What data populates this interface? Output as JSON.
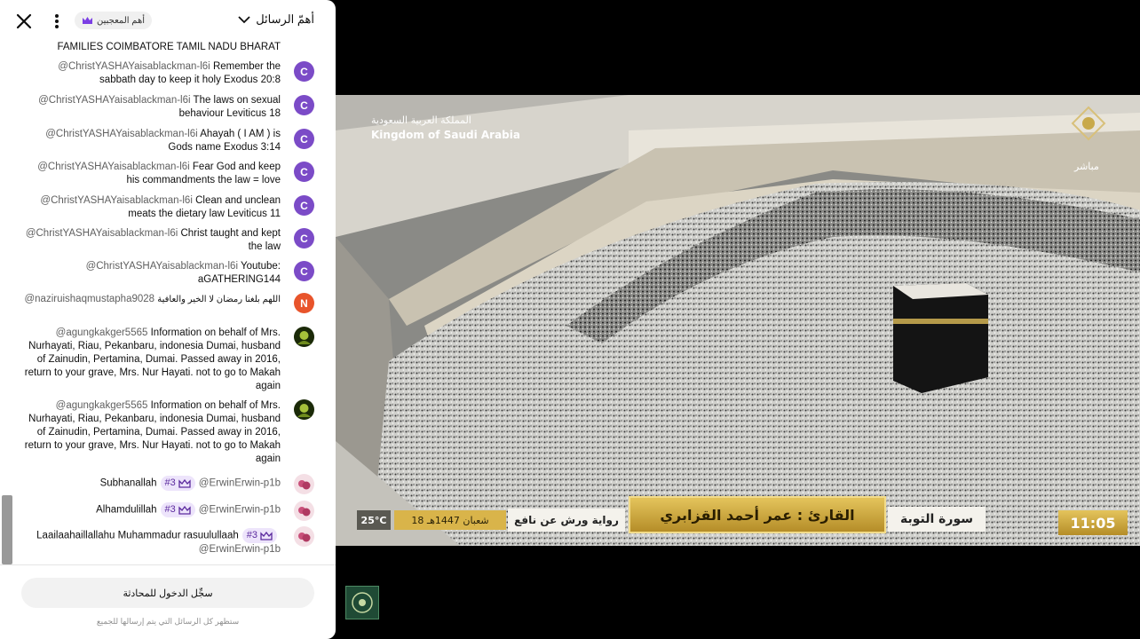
{
  "chat": {
    "header": {
      "title": "أهمّ الرسائل",
      "top_fans_label": "أهم المعجبين",
      "close_icon": "close-icon",
      "more_icon": "more-vert-icon",
      "dropdown_icon": "chevron-down-icon"
    },
    "partial_line": "FAMILIES COIMBATORE TAMIL NADU BHARAT",
    "messages": [
      {
        "author": "@ChristYASHAYaisablackman-l6i",
        "text": "Remember the sabbath day to keep it holy Exodus 20:8",
        "avatar": "C",
        "avatar_color": "#7b4bc7"
      },
      {
        "author": "@ChristYASHAYaisablackman-l6i",
        "text": "The laws on sexual behaviour Leviticus 18",
        "avatar": "C",
        "avatar_color": "#7b4bc7"
      },
      {
        "author": "@ChristYASHAYaisablackman-l6i",
        "text": "Ahayah ( I AM ) is Gods name Exodus 3:14",
        "avatar": "C",
        "avatar_color": "#7b4bc7"
      },
      {
        "author": "@ChristYASHAYaisablackman-l6i",
        "text": "Fear God and keep his commandments the law = love",
        "avatar": "C",
        "avatar_color": "#7b4bc7"
      },
      {
        "author": "@ChristYASHAYaisablackman-l6i",
        "text": "Clean and unclean meats the dietary law Leviticus 11",
        "avatar": "C",
        "avatar_color": "#7b4bc7"
      },
      {
        "author": "@ChristYASHAYaisablackman-l6i",
        "text": "Christ taught and kept the law",
        "avatar": "C",
        "avatar_color": "#7b4bc7"
      },
      {
        "author": "@ChristYASHAYaisablackman-l6i",
        "text": "Youtube: aGATHERING144",
        "avatar": "C",
        "avatar_color": "#7b4bc7"
      },
      {
        "author": "@naziruishaqmustapha9028",
        "text": "اللهم بلغنا رمضان لا الخير والعافية",
        "avatar": "N",
        "avatar_color": "#e8542b"
      },
      {
        "author": "@agungkakger5565",
        "text": "Information on behalf of Mrs. Nurhayati, Riau, Pekanbaru, indonesia Dumai, husband of Zainudin, Pertamina, Dumai. Passed away in 2016, return to your grave, Mrs. Nur Hayati. not to go to Makah again",
        "avatar": "",
        "avatar_color": "#3c5a14"
      },
      {
        "author": "@agungkakger5565",
        "text": "Information on behalf of Mrs. Nurhayati, Riau, Pekanbaru, indonesia Dumai, husband of Zainudin, Pertamina, Dumai. Passed away in 2016, return to your grave, Mrs. Nur Hayati. not to go to Makah again",
        "avatar": "",
        "avatar_color": "#3c5a14"
      },
      {
        "author": "@ErwinErwin-p1b",
        "badge": "#3",
        "text": "Subhanallah",
        "avatar": "",
        "avatar_color": "#c9507a"
      },
      {
        "author": "@ErwinErwin-p1b",
        "badge": "#3",
        "text": "Alhamdulillah",
        "avatar": "",
        "avatar_color": "#c9507a"
      },
      {
        "author": "@ErwinErwin-p1b",
        "badge": "#3",
        "text": "Laailaahaillallahu Muhammadur rasuulullaah",
        "avatar": "",
        "avatar_color": "#c9507a"
      }
    ],
    "footer": {
      "signin_label": "سجِّل الدخول للمحادثة",
      "notice": "ستظهر كل الرسائل التي يتم إرسالها للجميع"
    }
  },
  "video": {
    "logo_ar": "المملكة العربية السعودية",
    "logo_en": "Kingdom of Saudi Arabia",
    "live_label": "مباشر",
    "temperature": "25°C",
    "date": "18 شعبان 1447هـ",
    "riwaya": "رواية ورش عن نافع",
    "reciter": "القارئ : عمر أحمد القزابري",
    "surah": "سورة التوبة",
    "time": "11:05",
    "accent_gold": "#d9b44a"
  }
}
